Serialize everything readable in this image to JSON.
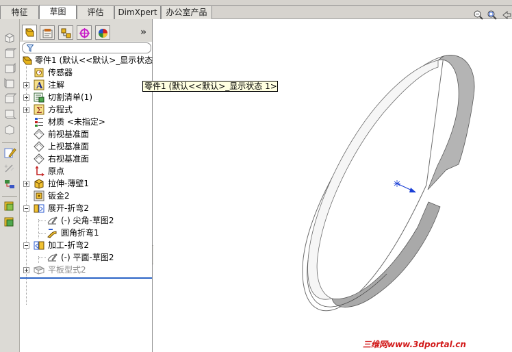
{
  "tabs": [
    {
      "label": "特征",
      "active": false
    },
    {
      "label": "草图",
      "active": true
    },
    {
      "label": "评估",
      "active": false
    },
    {
      "label": "DimXpert",
      "active": false
    },
    {
      "label": "办公室产品",
      "active": false
    }
  ],
  "feature_manager": {
    "more_symbol": "»",
    "tabs": [
      "feature-manager-icon",
      "property-manager-icon",
      "configuration-manager-icon",
      "dimxpert-manager-icon",
      "display-manager-icon"
    ],
    "tree": [
      {
        "label": "零件1  (默认<<默认>_显示状态",
        "icon": "part-icon"
      },
      {
        "label": "传感器",
        "icon": "sensor-icon"
      },
      {
        "label": "注解",
        "icon": "annotation-icon"
      },
      {
        "label": "切割清单(1)",
        "icon": "cut-list-icon"
      },
      {
        "label": "方程式",
        "icon": "equation-icon"
      },
      {
        "label": "材质 <未指定>",
        "icon": "material-icon"
      },
      {
        "label": "前视基准面",
        "icon": "plane-icon"
      },
      {
        "label": "上视基准面",
        "icon": "plane-icon"
      },
      {
        "label": "右视基准面",
        "icon": "plane-icon"
      },
      {
        "label": "原点",
        "icon": "origin-icon"
      },
      {
        "label": "拉伸-薄壁1",
        "icon": "extrude-icon"
      },
      {
        "label": "钣金2",
        "icon": "sheet-metal-icon"
      },
      {
        "label": "展开-折弯2",
        "icon": "unfold-icon"
      },
      {
        "label": "(-) 尖角-草图2",
        "icon": "sketch-icon"
      },
      {
        "label": "圆角折弯1",
        "icon": "bend-icon"
      },
      {
        "label": "加工-折弯2",
        "icon": "process-bend-icon"
      },
      {
        "label": "(-) 平面-草图2",
        "icon": "sketch-icon"
      },
      {
        "label": "平板型式2",
        "icon": "flat-pattern-icon"
      }
    ]
  },
  "tooltip": "零件1  (默认<<默认>_显示状态 1>)",
  "watermark": "三维网www.3dportal.cn",
  "colors": {
    "rollback_bar": "#2a63c6",
    "watermark": "#d21a1a",
    "tooltip_bg": "#ffffe1",
    "ring_outer": "#8e8e8e",
    "ring_inner": "#f4f4f4",
    "origin_arrow": "#1a3fd6"
  }
}
